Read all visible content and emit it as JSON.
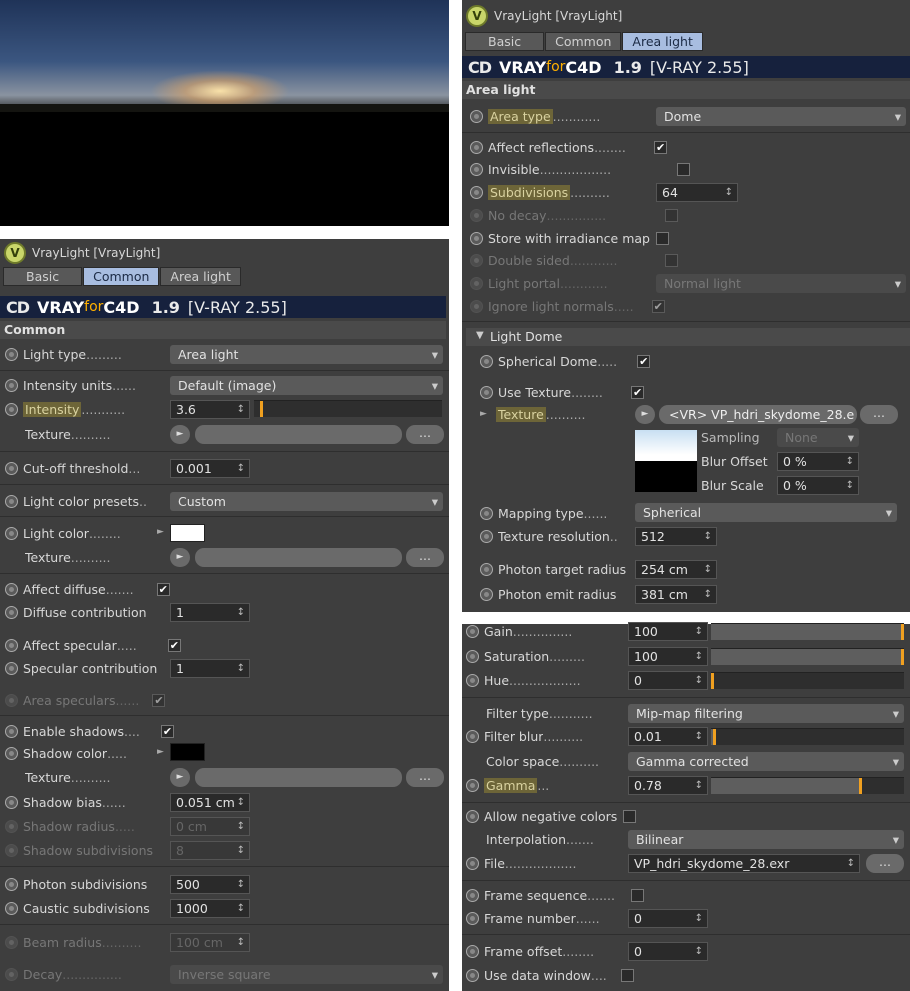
{
  "panelA": {
    "title": "VrayLight [VrayLight]",
    "tabs": [
      "Basic",
      "Common",
      "Area light"
    ],
    "brand": {
      "cd": "CD",
      "vray": "VRAY",
      "for": "for",
      "c4d": "C4D",
      "version": "1.9",
      "vr": "[V-RAY 2.55]"
    },
    "section": "Common",
    "rows": {
      "light_type": "Light type",
      "light_type_val": "Area light",
      "intensity_units": "Intensity units",
      "intensity_units_val": "Default (image)",
      "intensity": "Intensity",
      "intensity_val": "3.6",
      "texture1": "Texture",
      "cutoff": "Cut-off threshold",
      "cutoff_val": "0.001",
      "presets": "Light color presets",
      "presets_val": "Custom",
      "light_color": "Light color",
      "texture2": "Texture",
      "affect_diffuse": "Affect diffuse",
      "diffuse_contrib": "Diffuse contribution",
      "diffuse_contrib_val": "1",
      "affect_specular": "Affect specular",
      "specular_contrib": "Specular contribution",
      "specular_contrib_val": "1",
      "area_speculars": "Area speculars",
      "enable_shadows": "Enable shadows",
      "shadow_color": "Shadow color",
      "texture3": "Texture",
      "shadow_bias": "Shadow bias",
      "shadow_bias_val": "0.051 cm",
      "shadow_radius": "Shadow radius",
      "shadow_radius_val": "0 cm",
      "shadow_subdiv": "Shadow subdivisions",
      "shadow_subdiv_val": "8",
      "photon_subdiv": "Photon subdivisions",
      "photon_subdiv_val": "500",
      "caustic_subdiv": "Caustic subdivisions",
      "caustic_subdiv_val": "1000",
      "beam_radius": "Beam radius",
      "beam_radius_val": "100 cm",
      "decay": "Decay",
      "decay_val": "Inverse square",
      "dots": "..."
    },
    "intensity_fraction": 0.03
  },
  "panelB": {
    "title": "VrayLight [VrayLight]",
    "tabs": [
      "Basic",
      "Common",
      "Area light"
    ],
    "brand": {
      "cd": "CD",
      "vray": "VRAY",
      "for": "for",
      "c4d": "C4D",
      "version": "1.9",
      "vr": "[V-RAY 2.55]"
    },
    "section": "Area light",
    "rows": {
      "area_type": "Area type",
      "area_type_val": "Dome",
      "affect_reflections": "Affect reflections",
      "invisible": "Invisible",
      "subdivisions": "Subdivisions",
      "subdivisions_val": "64",
      "no_decay": "No decay",
      "store_irradiance": "Store with irradiance map",
      "double_sided": "Double sided",
      "light_portal": "Light portal",
      "light_portal_val": "Normal light",
      "ignore_normals": "Ignore light normals",
      "light_dome": "Light Dome",
      "spherical_dome": "Spherical Dome",
      "use_texture": "Use Texture",
      "texture": "Texture",
      "texture_val": "<VR> VP_hdri_skydome_28.e",
      "dots": "...",
      "sampling": "Sampling",
      "sampling_val": "None",
      "blur_offset": "Blur Offset",
      "blur_offset_val": "0 %",
      "blur_scale": "Blur Scale",
      "blur_scale_val": "0 %",
      "mapping_type": "Mapping type",
      "mapping_type_val": "Spherical",
      "texture_resolution": "Texture resolution",
      "texture_resolution_val": "512",
      "photon_target": "Photon target radius",
      "photon_target_val": "254 cm",
      "photon_emit": "Photon emit radius",
      "photon_emit_val": "381 cm"
    }
  },
  "panelC": {
    "rows": {
      "gain": "Gain",
      "gain_val": "100",
      "saturation": "Saturation",
      "saturation_val": "100",
      "hue": "Hue",
      "hue_val": "0",
      "filter_type": "Filter type",
      "filter_type_val": "Mip-map filtering",
      "filter_blur": "Filter blur",
      "filter_blur_val": "0.01",
      "color_space": "Color space",
      "color_space_val": "Gamma corrected",
      "gamma": "Gamma",
      "gamma_val": "0.78",
      "allow_negative": "Allow negative colors",
      "interpolation": "Interpolation",
      "interpolation_val": "Bilinear",
      "file": "File",
      "file_val": "VP_hdri_skydome_28.exr",
      "dots": "...",
      "frame_sequence": "Frame sequence",
      "frame_number": "Frame number",
      "frame_number_val": "0",
      "frame_offset": "Frame offset",
      "frame_offset_val": "0",
      "use_data_window": "Use data window"
    },
    "gain_fraction": 1.0,
    "saturation_fraction": 1.0,
    "hue_fraction": 0.0,
    "filter_blur_fraction": 0.01,
    "gamma_fraction": 0.78
  },
  "checked_glyph": "✔"
}
